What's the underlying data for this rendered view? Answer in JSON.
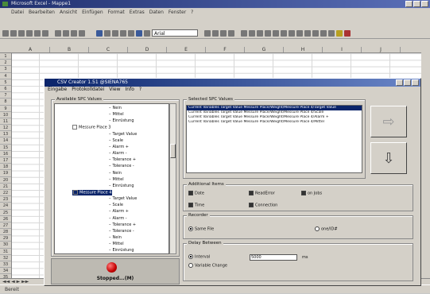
{
  "excel": {
    "title": "Microsoft Excel - Mappe1",
    "menu": [
      "Datei",
      "Bearbeiten",
      "Ansicht",
      "Einfügen",
      "Format",
      "Extras",
      "Daten",
      "Fenster",
      "?"
    ],
    "font": "Arial",
    "columns": [
      "A",
      "B",
      "C",
      "D",
      "E",
      "F",
      "G",
      "H",
      "I",
      "J"
    ],
    "rows": [
      "1",
      "2",
      "3",
      "4",
      "5",
      "6",
      "7",
      "8",
      "9",
      "10",
      "11",
      "12",
      "13",
      "14",
      "15",
      "16",
      "17",
      "18",
      "19",
      "20",
      "21",
      "22",
      "23",
      "24",
      "25",
      "26",
      "27",
      "28",
      "29",
      "30",
      "31",
      "32",
      "33",
      "34",
      "35"
    ],
    "sheet_nav": "◄◄ ◄ ► ►►",
    "status": "Bereit"
  },
  "dialog": {
    "title": "CSV Creator 1.51 @SIENA765",
    "menu": [
      "Eingabe",
      "Protokolldatei",
      "View",
      "Info",
      "?"
    ],
    "available_caption": "Available SPC Values",
    "tree": [
      {
        "label": "Nein",
        "level": 3
      },
      {
        "label": "Mittel",
        "level": 3
      },
      {
        "label": "Einrüstung",
        "level": 3
      },
      {
        "label": "Messure Place 3",
        "level": 2
      },
      {
        "label": "Target Value",
        "level": 3
      },
      {
        "label": "Scale",
        "level": 3
      },
      {
        "label": "Alarm +",
        "level": 3
      },
      {
        "label": "Alarm -",
        "level": 3
      },
      {
        "label": "Tolerance +",
        "level": 3
      },
      {
        "label": "Tolerance -",
        "level": 3
      },
      {
        "label": "Nein",
        "level": 3
      },
      {
        "label": "Mittel",
        "level": 3
      },
      {
        "label": "Einrüstung",
        "level": 3
      },
      {
        "label": "Messure Place 4",
        "level": 2,
        "selected": true
      },
      {
        "label": "Target Value",
        "level": 3
      },
      {
        "label": "Scale",
        "level": 3
      },
      {
        "label": "Alarm +",
        "level": 3
      },
      {
        "label": "Alarm -",
        "level": 3
      },
      {
        "label": "Tolerance +",
        "level": 3
      },
      {
        "label": "Tolerance -",
        "level": 3
      },
      {
        "label": "Nein",
        "level": 3
      },
      {
        "label": "Mittel",
        "level": 3
      },
      {
        "label": "Einrüstung",
        "level": 3
      }
    ],
    "status_label": "Stopped...(M)",
    "selected_caption": "Selected SPC Values",
    "selected_values": [
      "Current Variables Target Value Messure Place/Weight/Messure Place 4/Target Value",
      "Current Variables Target Value Messure Place/Weight/Messure Place 4/Scale",
      "Current Variables Target Value Messure Place/Weight/Messure Place 4/Alarm +",
      "Current Variables Target Value Messure Place/Weight/Messure Place 4/Mittel"
    ],
    "add_icon": "⇨",
    "remove_icon": "⇩",
    "additional_caption": "Additional Items",
    "additional": {
      "date": "Date",
      "time": "Time",
      "read_error": "ReadError",
      "connection": "Connection",
      "on_jobs": "on Jobs"
    },
    "recorder_caption": "Recorder",
    "recorder": {
      "same_file": "Same File",
      "one_per": "one/ID#"
    },
    "time_caption": "Delay Between",
    "time": {
      "interval": "Interval",
      "variable_change": "Variable Change",
      "interval_value": "5000",
      "unit": "ms"
    }
  }
}
